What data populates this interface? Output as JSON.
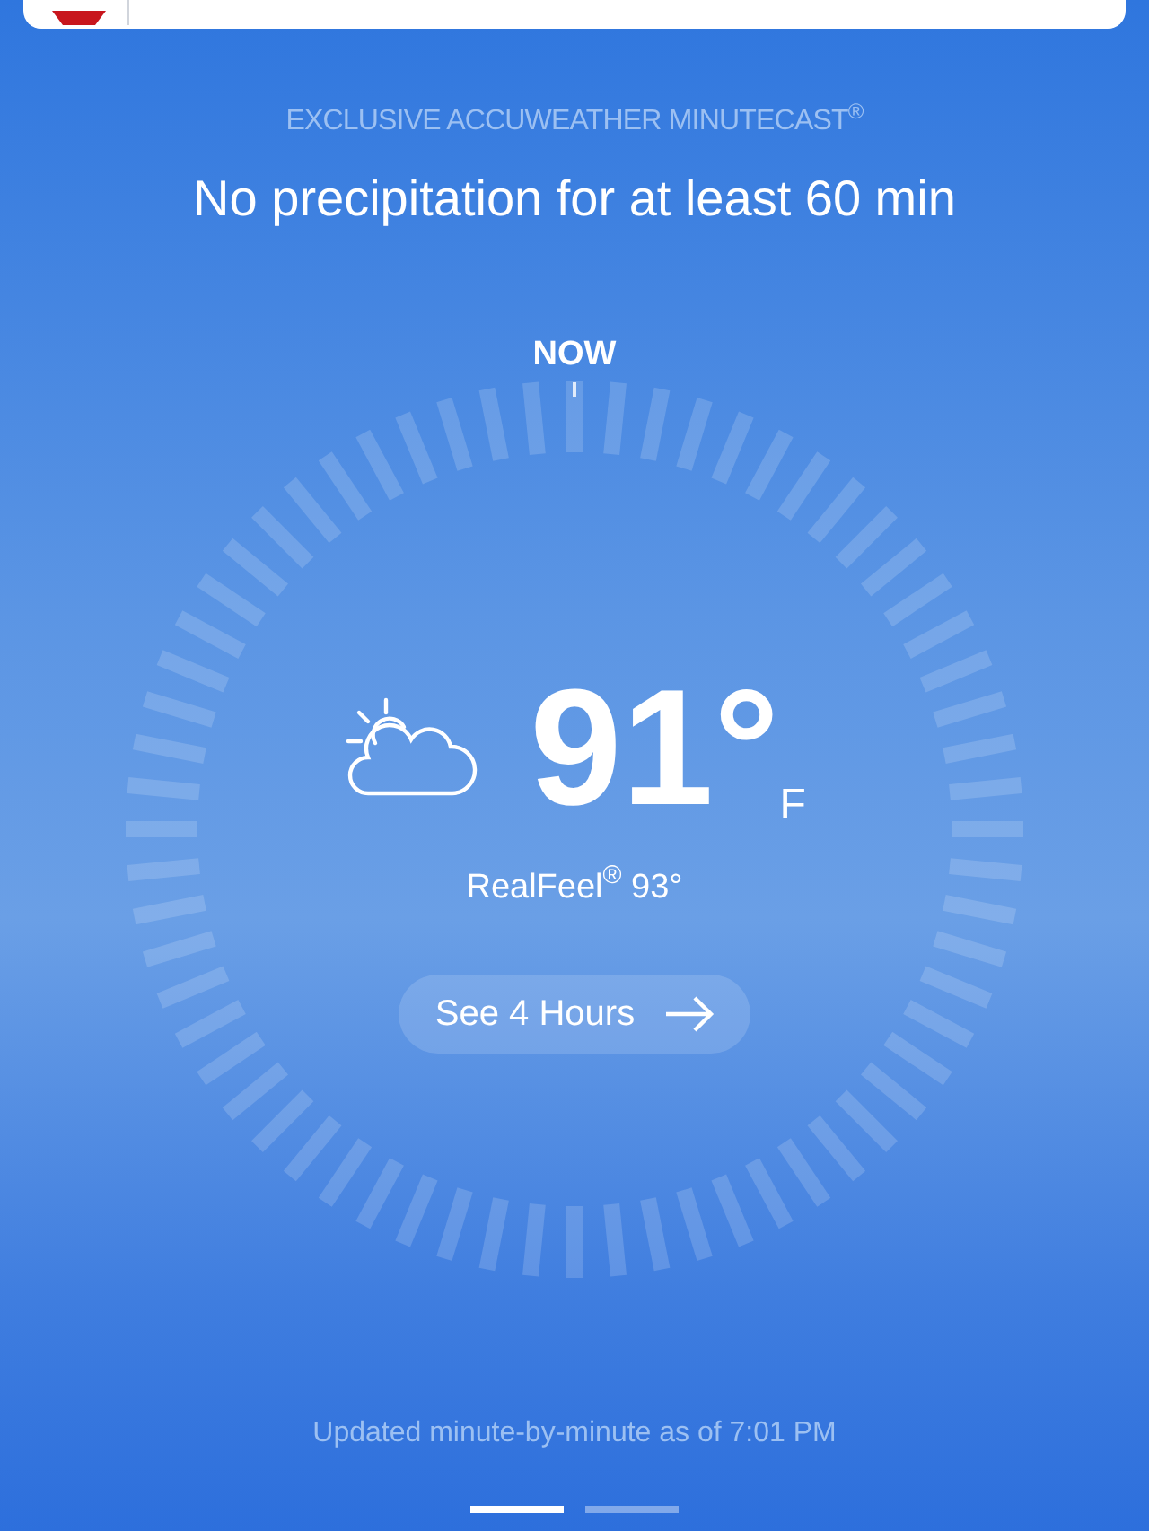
{
  "minutecast": {
    "eyebrow": "EXCLUSIVE ACCUWEATHER MINUTECAST$^{®}$",
    "headline": "No precipitation for at least 60 min",
    "now_label": "NOW"
  },
  "current": {
    "temperature": "91°",
    "unit": "F",
    "realfeel": "RealFeel$^{®}$ 93°"
  },
  "button": {
    "label": "See 4 Hours"
  },
  "footer": {
    "updated": "Updated minute-by-minute as of 7:01 PM"
  },
  "pages": [
    {
      "selected": true
    },
    {
      "selected": false
    }
  ]
}
